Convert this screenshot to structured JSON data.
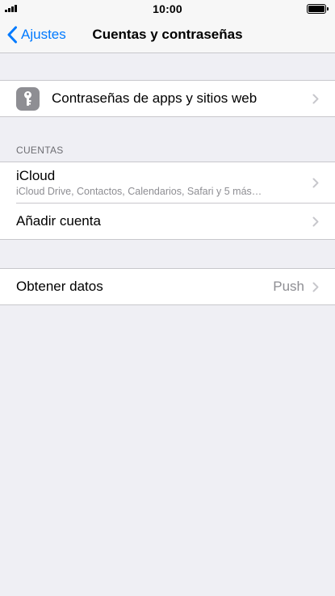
{
  "status_bar": {
    "time": "10:00"
  },
  "nav": {
    "back_label": "Ajustes",
    "title": "Cuentas y contraseñas"
  },
  "passwords_row": {
    "label": "Contraseñas de apps y sitios web",
    "icon": "key-icon"
  },
  "accounts_section": {
    "header": "CUENTAS",
    "items": [
      {
        "label": "iCloud",
        "subtitle": "iCloud Drive, Contactos, Calendarios, Safari y 5 más…"
      },
      {
        "label": "Añadir cuenta"
      }
    ]
  },
  "fetch_row": {
    "label": "Obtener datos",
    "value": "Push"
  },
  "colors": {
    "accent": "#007aff",
    "background": "#efeff4",
    "secondary_text": "#8e8e93",
    "separator": "#c8c7cc",
    "key_icon_background": "#8e8e93"
  }
}
